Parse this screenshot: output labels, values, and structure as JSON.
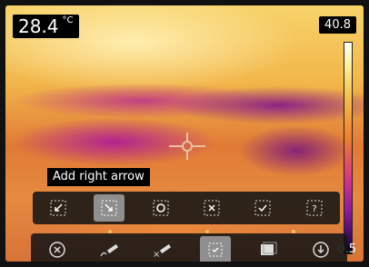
{
  "readout": {
    "temperature": "28.4",
    "unit": "°C"
  },
  "scale": {
    "max": "40.8",
    "min": "0.5"
  },
  "tooltip": {
    "text": "Add right arrow"
  },
  "tools_top": [
    {
      "icon": "arrow-down-left-icon"
    },
    {
      "icon": "arrow-down-right-icon",
      "selected": true
    },
    {
      "icon": "circle-icon"
    },
    {
      "icon": "x-mark-icon"
    },
    {
      "icon": "check-mark-icon"
    },
    {
      "icon": "question-mark-icon"
    }
  ],
  "tools_bottom": [
    {
      "icon": "close-icon"
    },
    {
      "icon": "pen-icon"
    },
    {
      "icon": "eraser-icon"
    },
    {
      "icon": "annotation-icon",
      "selected": true
    },
    {
      "icon": "image-icon"
    },
    {
      "icon": "download-icon"
    }
  ],
  "colors": {
    "accent": "#f0c060",
    "selected": "#8f8f8f"
  }
}
